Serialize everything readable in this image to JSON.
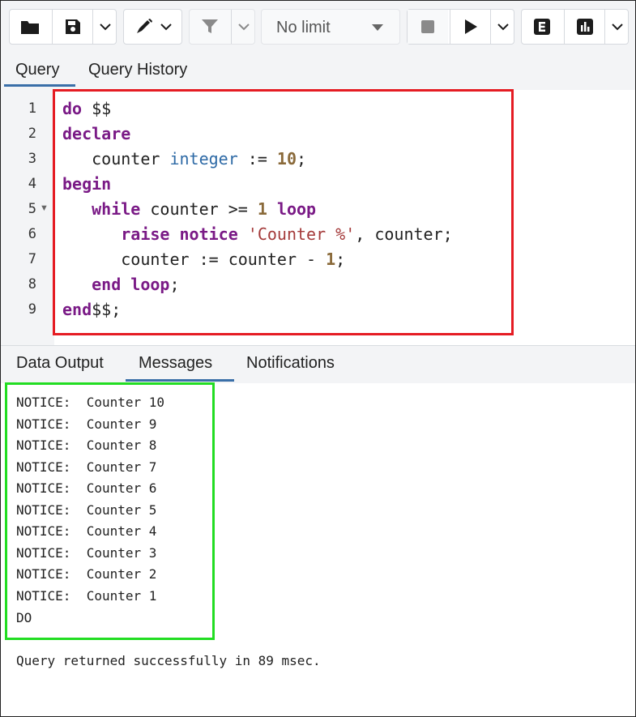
{
  "toolbar": {
    "limit_label": "No limit",
    "icons": [
      "folder-icon",
      "save-icon",
      "chevron-down-icon",
      "edit-icon",
      "filter-icon",
      "stop-icon",
      "play-icon",
      "explain-icon",
      "analyze-icon"
    ]
  },
  "query_tabs": [
    "Query",
    "Query History"
  ],
  "editor": {
    "line_numbers": [
      "1",
      "2",
      "3",
      "4",
      "5",
      "6",
      "7",
      "8",
      "9"
    ],
    "lines": [
      {
        "t1": "do",
        "t2": " $$"
      },
      {
        "t1": "declare"
      },
      {
        "t1": "   counter ",
        "t2": "integer",
        "t3": " := ",
        "t4": "10",
        "t5": ";"
      },
      {
        "t1": "begin"
      },
      {
        "t1": "   ",
        "t2": "while",
        "t3": " counter >= ",
        "t4": "1",
        "t5": " ",
        "t6": "loop"
      },
      {
        "t1": "      ",
        "t2": "raise notice",
        "t3": " ",
        "t4": "'Counter %'",
        "t5": ", counter;"
      },
      {
        "t1": "      counter := counter - ",
        "t2": "1",
        "t3": ";"
      },
      {
        "t1": "   ",
        "t2": "end loop",
        "t3": ";"
      },
      {
        "t1": "end",
        "t2": "$$;"
      }
    ]
  },
  "result_tabs": [
    "Data Output",
    "Messages",
    "Notifications"
  ],
  "messages": [
    "NOTICE:  Counter 10",
    "NOTICE:  Counter 9",
    "NOTICE:  Counter 8",
    "NOTICE:  Counter 7",
    "NOTICE:  Counter 6",
    "NOTICE:  Counter 5",
    "NOTICE:  Counter 4",
    "NOTICE:  Counter 3",
    "NOTICE:  Counter 2",
    "NOTICE:  Counter 1",
    "DO"
  ],
  "status": "Query returned successfully in 89 msec."
}
